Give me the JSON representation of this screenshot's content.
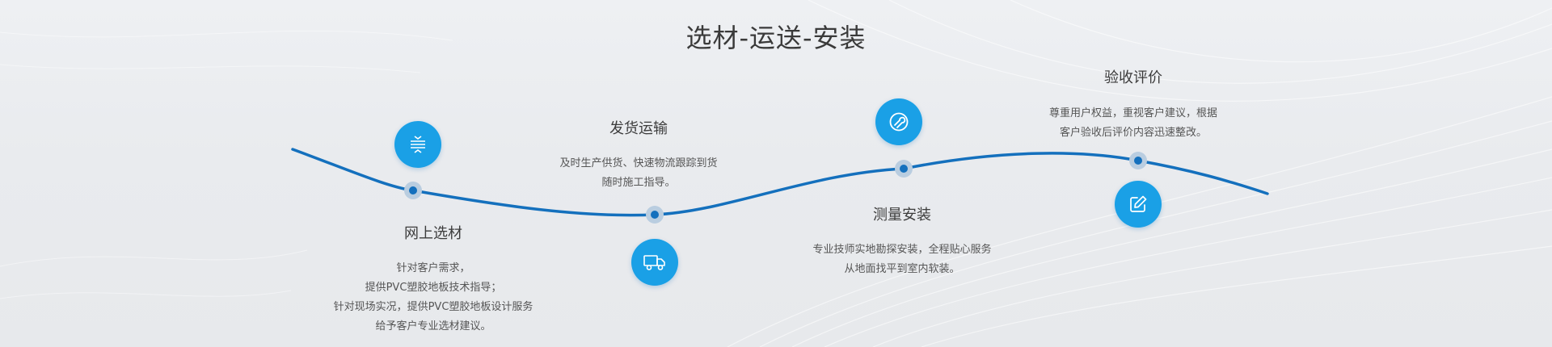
{
  "section": {
    "title": "选材-运送-安装"
  },
  "steps": [
    {
      "title": "网上选材",
      "icon": "layers-icon",
      "lines": [
        "针对客户需求，",
        "提供PVC塑胶地板技术指导；",
        "针对现场实况，提供PVC塑胶地板设计服务",
        "给予客户专业选材建议。"
      ]
    },
    {
      "title": "发货运输",
      "icon": "truck-icon",
      "lines": [
        "及时生产供货、快速物流跟踪到货",
        "随时施工指导。"
      ]
    },
    {
      "title": "测量安装",
      "icon": "wrench-icon",
      "lines": [
        "专业技师实地勘探安装，全程贴心服务",
        "从地面找平到室内软装。"
      ]
    },
    {
      "title": "验收评价",
      "icon": "edit-icon",
      "lines": [
        "尊重用户权益，重视客户建议，根据",
        "客户验收后评价内容迅速整改。"
      ]
    }
  ],
  "colors": {
    "accent": "#1aa0e6",
    "curve": "#1470bd",
    "node_halo": "#b9cde0"
  }
}
